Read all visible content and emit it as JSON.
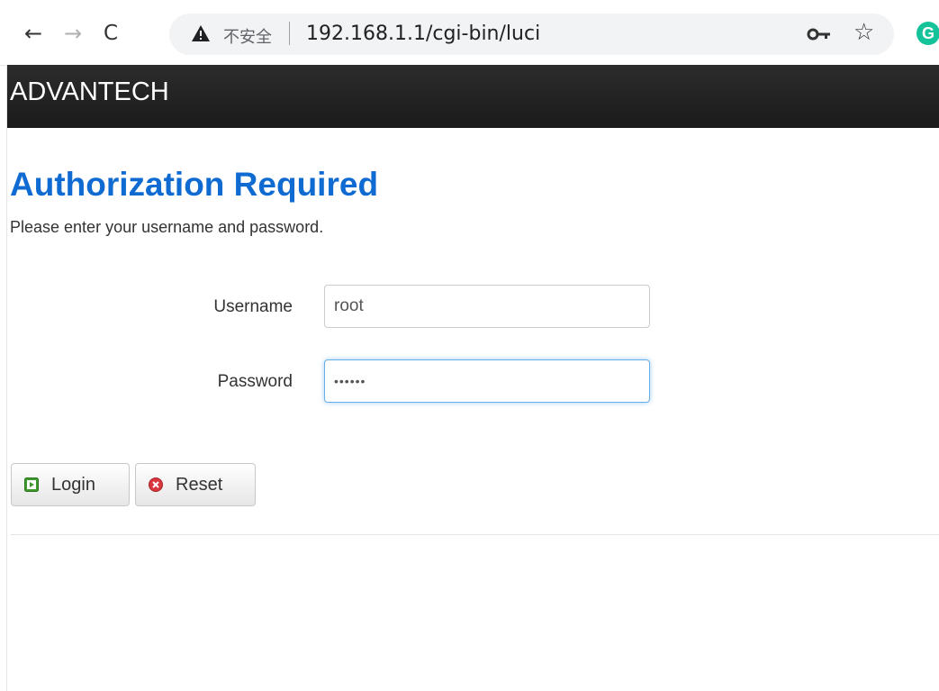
{
  "browser": {
    "security_label": "不安全",
    "url": "192.168.1.1/cgi-bin/luci",
    "extension_letter": "G"
  },
  "header": {
    "brand": "ADVANTECH"
  },
  "login": {
    "title": "Authorization Required",
    "description": "Please enter your username and password.",
    "username_label": "Username",
    "username_value": "root",
    "password_label": "Password",
    "password_value": "••••••",
    "login_button": "Login",
    "reset_button": "Reset"
  },
  "colors": {
    "title": "#0f6bd2",
    "header_bg": "#1f1f1f",
    "login_icon": "#3e9a2c",
    "reset_icon": "#d9363e"
  }
}
